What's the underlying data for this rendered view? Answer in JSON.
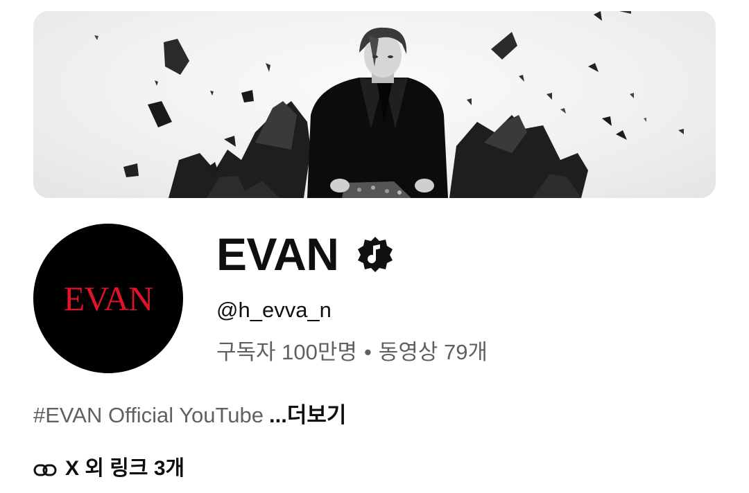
{
  "channel": {
    "name": "EVAN",
    "avatar_text": "EVAN",
    "handle": "@h_evva_n",
    "subscribers": "구독자 100만명",
    "separator": "•",
    "videos": "동영상 79개",
    "description": "#EVAN Official YouTube",
    "more_label": "...더보기",
    "links_label": "X 외 링크 3개"
  },
  "icons": {
    "badge": "music-note-badge-icon",
    "link": "link-icon"
  },
  "colors": {
    "avatar_bg": "#000000",
    "avatar_text": "#e0132a",
    "primary_text": "#0f0f0f",
    "secondary_text": "#606060"
  }
}
